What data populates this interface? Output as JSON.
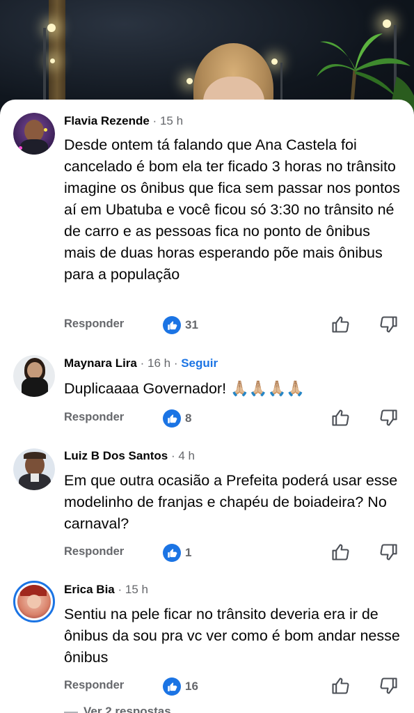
{
  "comments": [
    {
      "name": "Flavia Rezende",
      "time": "15 h",
      "text": "Desde ontem tá falando que Ana Castela foi cancelado é bom ela ter ficado 3 horas no trânsito imagine os ônibus que fica sem passar nos pontos aí em Ubatuba e você ficou só 3:30 no trânsito né de carro e as pessoas fica no ponto de ônibus mais de duas horas esperando  põe mais ônibus para a população",
      "reply_label": "Responder",
      "likes": "31"
    },
    {
      "name": "Maynara Lira",
      "time": "16 h",
      "follow_label": "Seguir",
      "text": "Duplicaaaa Governador! 🙏🏼🙏🏼🙏🏼🙏🏼",
      "reply_label": "Responder",
      "likes": "8"
    },
    {
      "name": "Luiz B Dos Santos",
      "time": "4 h",
      "text": "Em que outra ocasião a Prefeita poderá usar esse modelinho de franjas e chapéu de boiadeira? No carnaval?",
      "reply_label": "Responder",
      "likes": "1"
    },
    {
      "name": "Erica Bia",
      "time": "15 h",
      "text": "Sentiu na pele ficar no trânsito deveria era ir de ônibus da sou pra vc ver como é bom andar nesse ônibus",
      "reply_label": "Responder",
      "likes": "16"
    }
  ],
  "separator": " · ",
  "more_replies": "Ver 2 respostas",
  "icons": {
    "like_badge": "thumbs-up-icon",
    "upvote": "thumbs-up-outline-icon",
    "downvote": "thumbs-down-outline-icon"
  },
  "colors": {
    "accent": "#1b74e4",
    "secondary_text": "#65676b",
    "primary_text": "#050505"
  }
}
